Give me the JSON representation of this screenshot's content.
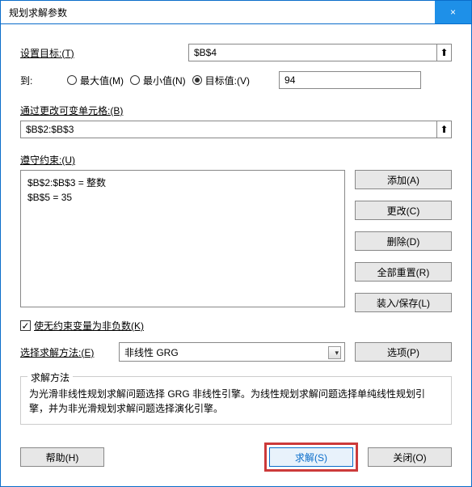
{
  "titlebar": {
    "title": "规划求解参数",
    "close": "×"
  },
  "target": {
    "label": "设置目标:(T)",
    "value": "$B$4"
  },
  "to": {
    "label": "到:",
    "max": "最大值(M)",
    "min": "最小值(N)",
    "valueOf": "目标值:(V)",
    "targetValue": "94"
  },
  "changing": {
    "label": "通过更改可变单元格:(B)",
    "value": "$B$2:$B$3"
  },
  "constraints": {
    "label": "遵守约束:(U)",
    "items": [
      "$B$2:$B$3 = 整数",
      "$B$5 = 35"
    ],
    "add": "添加(A)",
    "change": "更改(C)",
    "delete": "删除(D)",
    "resetAll": "全部重置(R)",
    "loadSave": "装入/保存(L)"
  },
  "nonneg": {
    "label": "使无约束变量为非负数(K)",
    "checked": "✓"
  },
  "method": {
    "label": "选择求解方法:(E)",
    "value": "非线性 GRG",
    "options": "选项(P)"
  },
  "help": {
    "legend": "求解方法",
    "text": "为光滑非线性规划求解问题选择 GRG 非线性引擎。为线性规划求解问题选择单纯线性规划引擎，并为非光滑规划求解问题选择演化引擎。"
  },
  "buttons": {
    "help": "帮助(H)",
    "solve": "求解(S)",
    "close": "关闭(O)"
  },
  "icons": {
    "collapse": "⬆",
    "chev": "▾"
  }
}
